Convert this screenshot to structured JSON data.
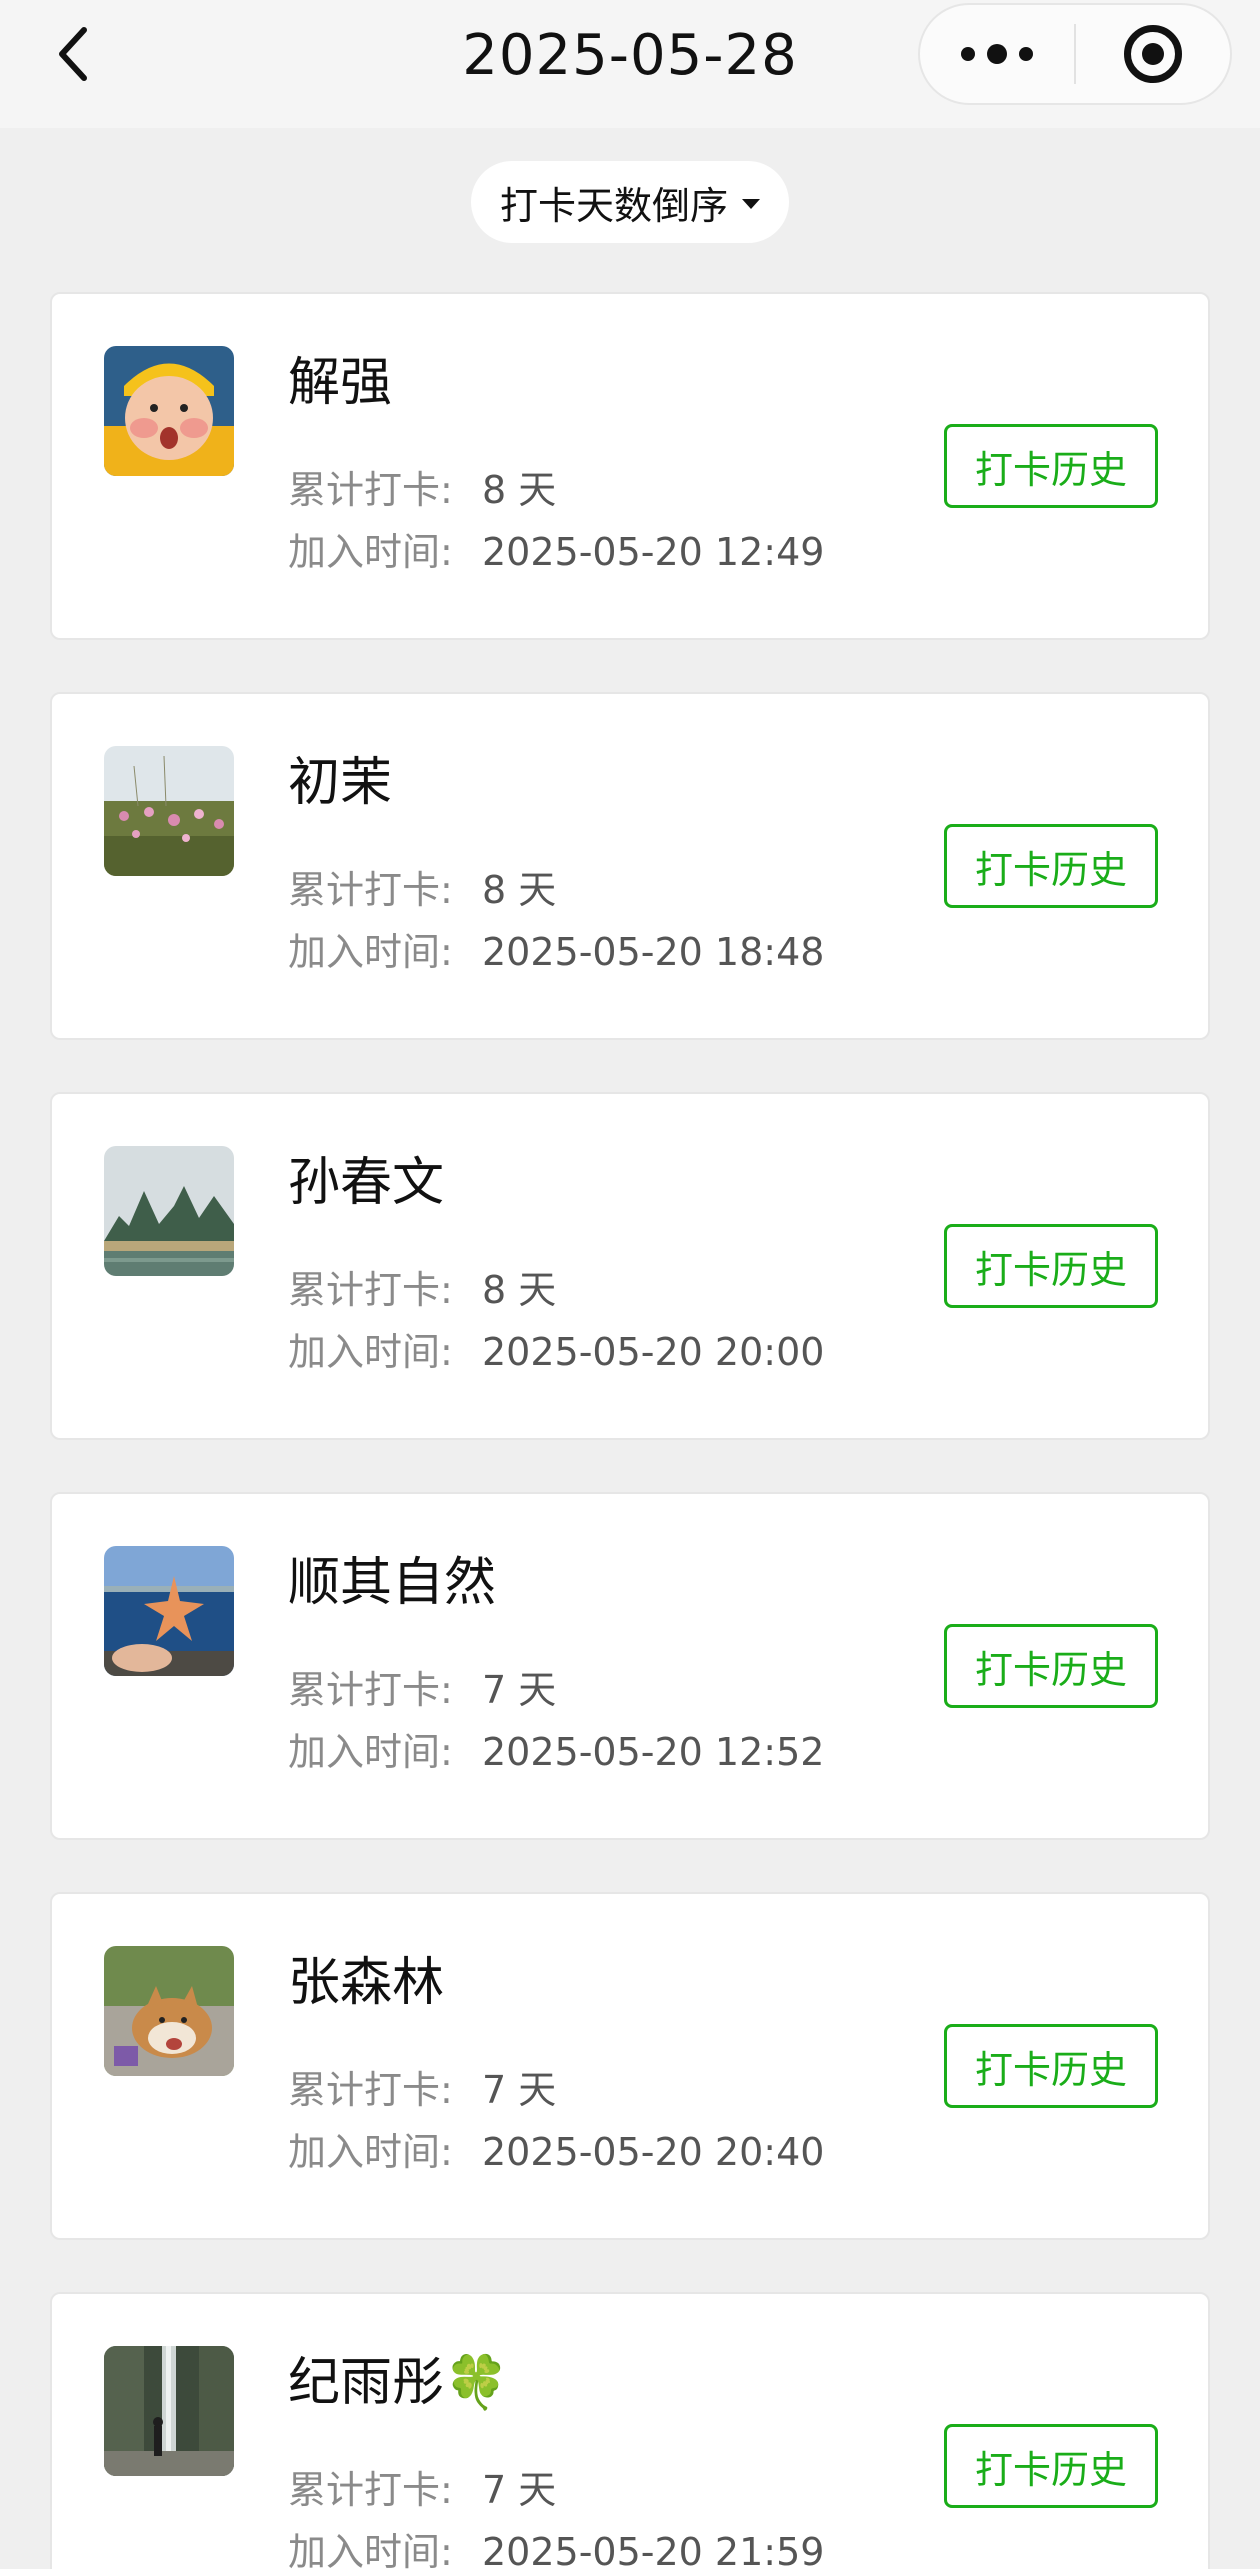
{
  "header": {
    "title": "2025-05-28"
  },
  "sort": {
    "label": "打卡天数倒序"
  },
  "labels": {
    "total": "累计打卡:",
    "joined": "加入时间:",
    "history_button": "打卡历史"
  },
  "members": [
    {
      "name": "解强",
      "days": "8 天",
      "joined": "2025-05-20 12:49"
    },
    {
      "name": "初茉",
      "days": "8 天",
      "joined": "2025-05-20 18:48"
    },
    {
      "name": "孙春文",
      "days": "8 天",
      "joined": "2025-05-20 20:00"
    },
    {
      "name": "顺其自然",
      "days": "7 天",
      "joined": "2025-05-20 12:52"
    },
    {
      "name": "张森林",
      "days": "7 天",
      "joined": "2025-05-20 20:40"
    },
    {
      "name": "纪雨彤🍀",
      "days": "7 天",
      "joined": "2025-05-20 21:59"
    }
  ],
  "colors": {
    "accent": "#1aad19",
    "background": "#efefef"
  }
}
